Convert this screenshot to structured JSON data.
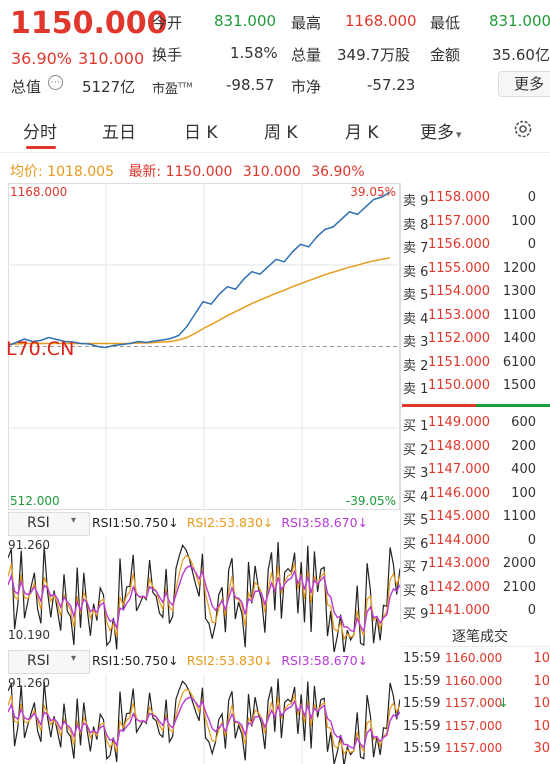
{
  "header": {
    "price": "1150.000",
    "change_pct": "36.90%",
    "change": "310.000",
    "market_cap_label": "总值",
    "market_cap": "5127亿",
    "fields": [
      {
        "label": "今开",
        "value": "831.000",
        "color": "green"
      },
      {
        "label": "最高",
        "value": "1168.000",
        "color": "red"
      },
      {
        "label": "最低",
        "value": "831.000",
        "color": "green"
      },
      {
        "label": "换手",
        "value": "1.58%",
        "color": "dark"
      },
      {
        "label": "总量",
        "value": "349.7万股",
        "color": "dark"
      },
      {
        "label": "金额",
        "value": "35.60亿",
        "color": "dark"
      },
      {
        "label": "市盈",
        "label_sup": "TTM",
        "value": "-98.57",
        "color": "dark"
      },
      {
        "label": "市净",
        "value": "-57.23",
        "color": "dark"
      }
    ],
    "more_button": "更多"
  },
  "tabs": {
    "items": [
      "分时",
      "五日",
      "日 K",
      "周 K",
      "月 K",
      "更多"
    ],
    "active": 0,
    "more_caret": "▾"
  },
  "info_line": {
    "avg_label": "均价:",
    "avg_value": "1018.005",
    "latest_label": "最新:",
    "latest_value": "1150.000",
    "change": "310.000",
    "change_pct": "36.90%"
  },
  "chart_data": [
    {
      "type": "line",
      "y_top_label": "1168.000",
      "y_bottom_label": "512.000",
      "pct_top_label": "39.05%",
      "pct_bottom_label": "-39.05%",
      "ylim": [
        512,
        1168
      ],
      "reference": 840,
      "series": [
        {
          "name": "最新",
          "color": "#2f6fb3",
          "values": [
            842,
            848,
            855,
            850,
            852,
            858,
            854,
            850,
            849,
            846,
            845,
            840,
            838,
            842,
            844,
            846,
            850,
            848,
            851,
            853,
            856,
            862,
            880,
            905,
            930,
            925,
            945,
            960,
            955,
            975,
            990,
            985,
            1000,
            1015,
            1010,
            1030,
            1045,
            1040,
            1060,
            1075,
            1080,
            1095,
            1110,
            1105,
            1120,
            1135,
            1140,
            1150
          ]
        },
        {
          "name": "均价",
          "color": "#e89a1c",
          "values": [
            845,
            845,
            846,
            846,
            846,
            846,
            846,
            846,
            846,
            846,
            846,
            846,
            846,
            846,
            846,
            846,
            847,
            847,
            848,
            849,
            850,
            853,
            858,
            866,
            876,
            884,
            893,
            902,
            910,
            918,
            926,
            933,
            940,
            947,
            953,
            960,
            966,
            972,
            978,
            984,
            989,
            994,
            999,
            1003,
            1008,
            1012,
            1015,
            1018
          ]
        }
      ]
    },
    {
      "type": "line",
      "title": "RSI",
      "ylim": [
        10.19,
        91.26
      ],
      "y_top_label": "91.260",
      "y_bottom_label": "10.190",
      "legend": [
        {
          "label": "RSI1:50.750",
          "arrow": "↓",
          "color": "#222222"
        },
        {
          "label": "RSI2:53.830",
          "arrow": "↓",
          "color": "#e89a1c"
        },
        {
          "label": "RSI3:58.670",
          "arrow": "↓",
          "color": "#b73ad6"
        }
      ]
    },
    {
      "type": "line",
      "title": "RSI",
      "y_top_label": "91.260",
      "legend": [
        {
          "label": "RSI1:50.750",
          "arrow": "↓",
          "color": "#222222"
        },
        {
          "label": "RSI2:53.830",
          "arrow": "↓",
          "color": "#e89a1c"
        },
        {
          "label": "RSI3:58.670",
          "arrow": "↓",
          "color": "#b73ad6"
        }
      ]
    }
  ],
  "watermark": "L70.CN",
  "orderbook": {
    "asks": [
      {
        "label": "卖 9",
        "price": "1158.000",
        "vol": "0"
      },
      {
        "label": "卖 8",
        "price": "1157.000",
        "vol": "100"
      },
      {
        "label": "卖 7",
        "price": "1156.000",
        "vol": "0"
      },
      {
        "label": "卖 6",
        "price": "1155.000",
        "vol": "1200"
      },
      {
        "label": "卖 5",
        "price": "1154.000",
        "vol": "1300"
      },
      {
        "label": "卖 4",
        "price": "1153.000",
        "vol": "1100"
      },
      {
        "label": "卖 3",
        "price": "1152.000",
        "vol": "1400"
      },
      {
        "label": "卖 2",
        "price": "1151.000",
        "vol": "6100"
      },
      {
        "label": "卖 1",
        "price": "1150.000",
        "vol": "1500"
      }
    ],
    "bids": [
      {
        "label": "买 1",
        "price": "1149.000",
        "vol": "600"
      },
      {
        "label": "买 2",
        "price": "1148.000",
        "vol": "200"
      },
      {
        "label": "买 3",
        "price": "1147.000",
        "vol": "400"
      },
      {
        "label": "买 4",
        "price": "1146.000",
        "vol": "100"
      },
      {
        "label": "买 5",
        "price": "1145.000",
        "vol": "1100"
      },
      {
        "label": "买 6",
        "price": "1144.000",
        "vol": "0"
      },
      {
        "label": "买 7",
        "price": "1143.000",
        "vol": "2000"
      },
      {
        "label": "买 8",
        "price": "1142.000",
        "vol": "2100"
      },
      {
        "label": "买 9",
        "price": "1141.000",
        "vol": "0"
      }
    ]
  },
  "ticks": {
    "header": "逐笔成交",
    "rows": [
      {
        "time": "15:59",
        "price": "1160.000",
        "arrow": "",
        "vol": "10"
      },
      {
        "time": "15:59",
        "price": "1160.000",
        "arrow": "",
        "vol": "10"
      },
      {
        "time": "15:59",
        "price": "1157.000",
        "arrow": "↓",
        "vol": "10"
      },
      {
        "time": "15:59",
        "price": "1157.000",
        "arrow": "",
        "vol": "10"
      },
      {
        "time": "15:59",
        "price": "1157.000",
        "arrow": "",
        "vol": "30"
      }
    ]
  }
}
